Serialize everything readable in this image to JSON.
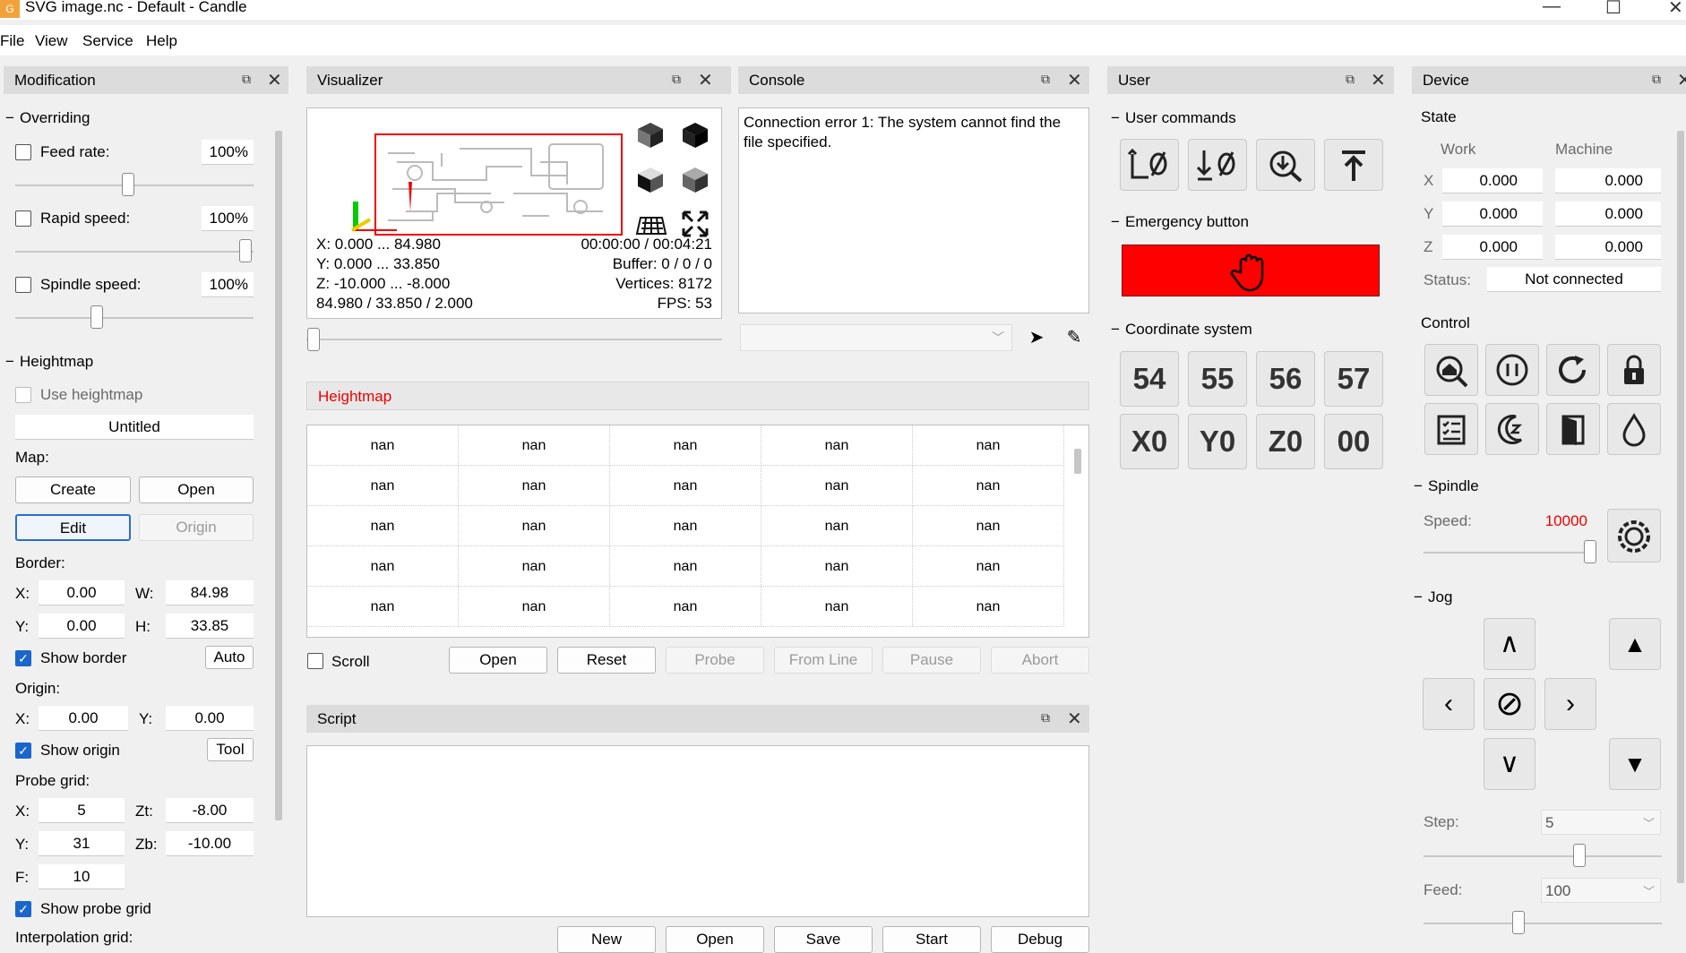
{
  "window": {
    "icon_text": "G",
    "title": "SVG image.nc - Default - Candle",
    "minimize": "—",
    "maximize": "☐",
    "close": "✕"
  },
  "menu": [
    "File",
    "View",
    "Service",
    "Help"
  ],
  "modification": {
    "title": "Modification",
    "overriding": {
      "label": "Overriding",
      "feed_rate": {
        "label": "Feed rate:",
        "value": "100%",
        "slider": 0.5
      },
      "rapid_speed": {
        "label": "Rapid speed:",
        "value": "100%",
        "slider": 1.0
      },
      "spindle_speed": {
        "label": "Spindle speed:",
        "value": "100%",
        "slider": 0.35
      }
    },
    "heightmap": {
      "label": "Heightmap",
      "use_heightmap": "Use heightmap",
      "name": "Untitled",
      "map_label": "Map:",
      "create": "Create",
      "open": "Open",
      "edit": "Edit",
      "origin_btn": "Origin",
      "border_label": "Border:",
      "x_label": "X:",
      "x_value": "0.00",
      "w_label": "W:",
      "w_value": "84.98",
      "y_label": "Y:",
      "y_value": "0.00",
      "h_label": "H:",
      "h_value": "33.85",
      "show_border": "Show border",
      "auto": "Auto",
      "origin_label": "Origin:",
      "ox_label": "X:",
      "ox_value": "0.00",
      "oy_label": "Y:",
      "oy_value": "0.00",
      "show_origin": "Show origin",
      "tool": "Tool",
      "probe_grid_label": "Probe grid:",
      "px_label": "X:",
      "px_value": "5",
      "zt_label": "Zt:",
      "zt_value": "-8.00",
      "py_label": "Y:",
      "py_value": "31",
      "zb_label": "Zb:",
      "zb_value": "-10.00",
      "f_label": "F:",
      "f_value": "10",
      "show_probe_grid": "Show probe grid",
      "interpolation_grid": "Interpolation grid:"
    }
  },
  "visualizer": {
    "title": "Visualizer",
    "x_range": "X: 0.000 ... 84.980",
    "y_range": "Y: 0.000 ... 33.850",
    "z_range": "Z: -10.000 ... -8.000",
    "size": "84.980 / 33.850 / 2.000",
    "time": "00:00:00 / 00:04:21",
    "buffer": "Buffer: 0 / 0 / 0",
    "vertices": "Vertices: 8172",
    "fps": "FPS: 53"
  },
  "console": {
    "title": "Console",
    "text": "Connection error 1: The system cannot find the file specified."
  },
  "heightmap_table": {
    "title": "Heightmap",
    "rows": [
      [
        "nan",
        "nan",
        "nan",
        "nan",
        "nan"
      ],
      [
        "nan",
        "nan",
        "nan",
        "nan",
        "nan"
      ],
      [
        "nan",
        "nan",
        "nan",
        "nan",
        "nan"
      ],
      [
        "nan",
        "nan",
        "nan",
        "nan",
        "nan"
      ],
      [
        "nan",
        "nan",
        "nan",
        "nan",
        "nan"
      ]
    ],
    "scroll": "Scroll",
    "open": "Open",
    "reset": "Reset",
    "probe": "Probe",
    "from_line": "From Line",
    "pause": "Pause",
    "abort": "Abort"
  },
  "script": {
    "title": "Script",
    "new": "New",
    "open": "Open",
    "save": "Save",
    "start": "Start",
    "debug": "Debug"
  },
  "user": {
    "title": "User",
    "user_commands": "User commands",
    "emergency": "Emergency button",
    "coord_system": "Coordinate system",
    "coords": [
      "54",
      "55",
      "56",
      "57",
      "X0",
      "Y0",
      "Z0",
      "00"
    ]
  },
  "device": {
    "title": "Device",
    "state_label": "State",
    "work": "Work",
    "machine": "Machine",
    "axes": [
      {
        "label": "X",
        "work": "0.000",
        "machine": "0.000"
      },
      {
        "label": "Y",
        "work": "0.000",
        "machine": "0.000"
      },
      {
        "label": "Z",
        "work": "0.000",
        "machine": "0.000"
      }
    ],
    "status_label": "Status:",
    "status_value": "Not connected",
    "control_label": "Control",
    "spindle_label": "Spindle",
    "speed_label": "Speed:",
    "speed_value": "10000",
    "jog_label": "Jog",
    "step_label": "Step:",
    "step_value": "5",
    "feed_label": "Feed:",
    "feed_value": "100"
  },
  "colors": {
    "emergency": "#ff0000",
    "accent": "#1a66cc",
    "warning_text": "#e00000"
  }
}
